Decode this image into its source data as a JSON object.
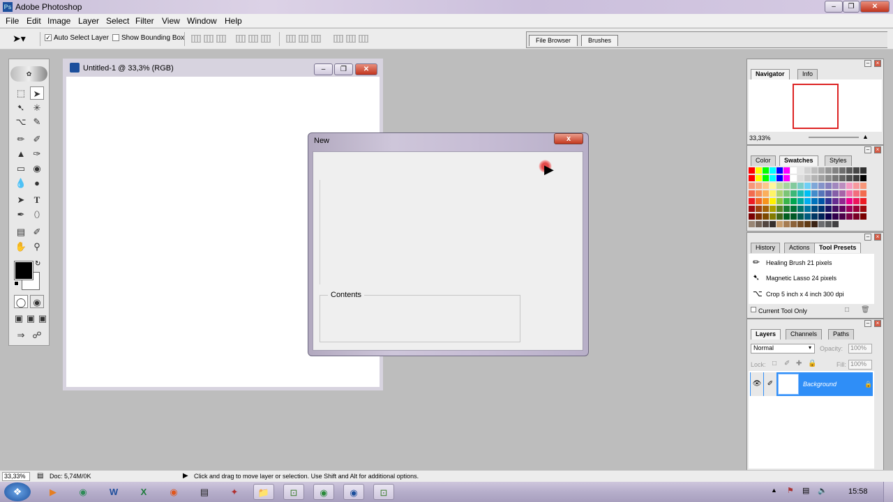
{
  "app": {
    "title": "Adobe Photoshop"
  },
  "menubar": [
    "File",
    "Edit",
    "Image",
    "Layer",
    "Select",
    "Filter",
    "View",
    "Window",
    "Help"
  ],
  "options": {
    "auto_select_label": "Auto Select Layer",
    "auto_select_checked": true,
    "bounding_box_label": "Show Bounding Box",
    "bounding_box_checked": false,
    "well_tabs": [
      "File Browser",
      "Brushes"
    ]
  },
  "document": {
    "title": "Untitled-1 @ 33,3% (RGB)"
  },
  "dialog": {
    "title": "New",
    "close_glyph": "x",
    "group_label": "Contents"
  },
  "navigator": {
    "tabs": [
      "Navigator",
      "Info"
    ],
    "zoom": "33,33%"
  },
  "color_panel": {
    "tabs": [
      "Color",
      "Swatches",
      "Styles"
    ],
    "active": "Swatches",
    "swatch_rows": [
      [
        "#ff0000",
        "#ffff00",
        "#00ff00",
        "#00ffff",
        "#0000ff",
        "#ff00ff",
        "#ffffff",
        "#e6e6e6",
        "#d2d2d2",
        "#bebebe",
        "#aaaaaa",
        "#969696",
        "#828282",
        "#6e6e6e",
        "#5a5a5a",
        "#464646",
        "#323232"
      ],
      [
        "#ff0000",
        "#ffff00",
        "#00ff00",
        "#00ffff",
        "#0000ff",
        "#ff00ff",
        "#ffffff",
        "#dcdcdc",
        "#c8c8c8",
        "#b4b4b4",
        "#a0a0a0",
        "#8c8c8c",
        "#787878",
        "#646464",
        "#505050",
        "#3c3c3c",
        "#000000"
      ],
      [
        "#f7977a",
        "#f9ad81",
        "#fdc68a",
        "#fff79a",
        "#c4df9b",
        "#a3d39c",
        "#82ca9d",
        "#7bcdc8",
        "#6ecff6",
        "#7ea7d8",
        "#8493ca",
        "#8882be",
        "#a187be",
        "#bc8dbf",
        "#f49ac2",
        "#f6989d",
        "#f7977a"
      ],
      [
        "#f26c4f",
        "#f68e55",
        "#fbaf5c",
        "#fff467",
        "#acd372",
        "#7cc576",
        "#3bb878",
        "#1abbb4",
        "#00bff3",
        "#438ccb",
        "#5574b9",
        "#605ca8",
        "#855fa8",
        "#a763a8",
        "#f06eaa",
        "#f26d7d",
        "#f26c4f"
      ],
      [
        "#ed1c24",
        "#f26522",
        "#f7941d",
        "#fff200",
        "#8dc73f",
        "#39b54a",
        "#00a651",
        "#00a99d",
        "#00aeef",
        "#0072bc",
        "#0054a6",
        "#2e3192",
        "#662d91",
        "#92278f",
        "#ec008c",
        "#ed145b",
        "#ed1c24"
      ],
      [
        "#9e0b0f",
        "#a0410d",
        "#a36209",
        "#aba000",
        "#598527",
        "#1a7b30",
        "#007236",
        "#00746b",
        "#0076a3",
        "#004b80",
        "#003471",
        "#1b1464",
        "#440e62",
        "#630460",
        "#9e005d",
        "#9e0039",
        "#9e0b0f"
      ],
      [
        "#790000",
        "#7b2e00",
        "#7d4900",
        "#827b00",
        "#406618",
        "#005e20",
        "#005826",
        "#005952",
        "#005b7f",
        "#003663",
        "#002157",
        "#0d004c",
        "#32004b",
        "#4b0049",
        "#7b0046",
        "#7a0026",
        "#790000"
      ],
      [
        "#998675",
        "#736357",
        "#534741",
        "#362f2d",
        "#c69c6d",
        "#a67c52",
        "#8c6239",
        "#754c24",
        "#603913",
        "#3c2415",
        "#6d6e71",
        "#58595b",
        "#414042"
      ]
    ]
  },
  "presets_panel": {
    "tabs": [
      "History",
      "Actions",
      "Tool Presets"
    ],
    "active": "Tool Presets",
    "items": [
      "Healing Brush 21 pixels",
      "Magnetic Lasso 24 pixels",
      "Crop 5 inch x 4 inch 300 dpi"
    ],
    "current_tool_only": "Current Tool Only"
  },
  "layers_panel": {
    "tabs": [
      "Layers",
      "Channels",
      "Paths"
    ],
    "active": "Layers",
    "blend_mode": "Normal",
    "opacity_label": "Opacity:",
    "opacity": "100%",
    "lock_label": "Lock:",
    "fill_label": "Fill:",
    "fill": "100%",
    "layer_name": "Background"
  },
  "status": {
    "zoom": "33,33%",
    "doc": "Doc: 5,74M/0K",
    "hint": "Click and drag to move layer or selection.  Use Shift and Alt for additional options."
  },
  "taskbar": {
    "time": "15:58",
    "apps": [
      "media-player-icon",
      "chrome-like-icon",
      "word-icon",
      "excel-icon",
      "firefox-icon",
      "notepad-icon",
      "app-icon",
      "folder-icon",
      "camtasia-icon",
      "chrome-icon",
      "photoshop-icon",
      "camtasia-2-icon"
    ]
  }
}
